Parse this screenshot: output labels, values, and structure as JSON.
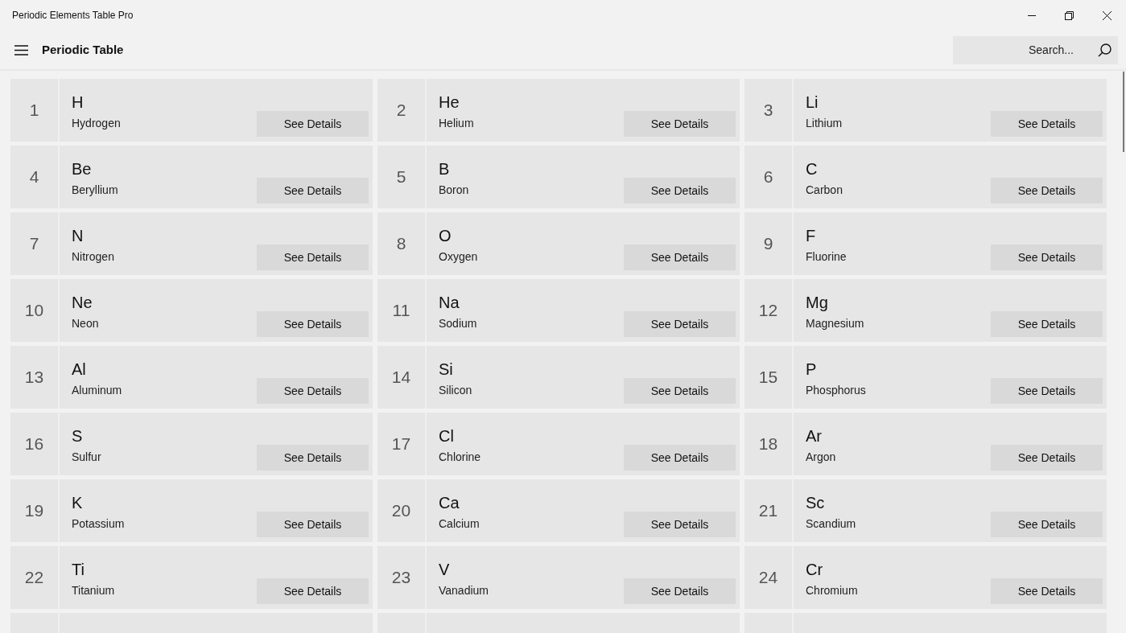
{
  "window": {
    "title": "Periodic Elements Table Pro"
  },
  "header": {
    "title": "Periodic Table",
    "search": {
      "placeholder": "Search..."
    }
  },
  "elements": [
    {
      "kind": "full",
      "number": "1",
      "symbol": "H",
      "name": "Hydrogen",
      "button": "See Details"
    },
    {
      "kind": "full",
      "number": "2",
      "symbol": "He",
      "name": "Helium",
      "button": "See Details"
    },
    {
      "kind": "full",
      "number": "3",
      "symbol": "Li",
      "name": "Lithium",
      "button": "See Details"
    },
    {
      "kind": "full",
      "number": "4",
      "symbol": "Be",
      "name": "Beryllium",
      "button": "See Details"
    },
    {
      "kind": "full",
      "number": "5",
      "symbol": "B",
      "name": "Boron",
      "button": "See Details"
    },
    {
      "kind": "full",
      "number": "6",
      "symbol": "C",
      "name": "Carbon",
      "button": "See Details"
    },
    {
      "kind": "full",
      "number": "7",
      "symbol": "N",
      "name": "Nitrogen",
      "button": "See Details"
    },
    {
      "kind": "full",
      "number": "8",
      "symbol": "O",
      "name": "Oxygen",
      "button": "See Details"
    },
    {
      "kind": "full",
      "number": "9",
      "symbol": "F",
      "name": "Fluorine",
      "button": "See Details"
    },
    {
      "kind": "full",
      "number": "10",
      "symbol": "Ne",
      "name": "Neon",
      "button": "See Details"
    },
    {
      "kind": "full",
      "number": "11",
      "symbol": "Na",
      "name": "Sodium",
      "button": "See Details"
    },
    {
      "kind": "full",
      "number": "12",
      "symbol": "Mg",
      "name": "Magnesium",
      "button": "See Details"
    },
    {
      "kind": "full",
      "number": "13",
      "symbol": "Al",
      "name": "Aluminum",
      "button": "See Details"
    },
    {
      "kind": "full",
      "number": "14",
      "symbol": "Si",
      "name": "Silicon",
      "button": "See Details"
    },
    {
      "kind": "full",
      "number": "15",
      "symbol": "P",
      "name": "Phosphorus",
      "button": "See Details"
    },
    {
      "kind": "full",
      "number": "16",
      "symbol": "S",
      "name": "Sulfur",
      "button": "See Details"
    },
    {
      "kind": "full",
      "number": "17",
      "symbol": "Cl",
      "name": "Chlorine",
      "button": "See Details"
    },
    {
      "kind": "full",
      "number": "18",
      "symbol": "Ar",
      "name": "Argon",
      "button": "See Details"
    },
    {
      "kind": "full",
      "number": "19",
      "symbol": "K",
      "name": "Potassium",
      "button": "See Details"
    },
    {
      "kind": "full",
      "number": "20",
      "symbol": "Ca",
      "name": "Calcium",
      "button": "See Details"
    },
    {
      "kind": "full",
      "number": "21",
      "symbol": "Sc",
      "name": "Scandium",
      "button": "See Details"
    },
    {
      "kind": "full",
      "number": "22",
      "symbol": "Ti",
      "name": "Titanium",
      "button": "See Details"
    },
    {
      "kind": "full",
      "number": "23",
      "symbol": "V",
      "name": "Vanadium",
      "button": "See Details"
    },
    {
      "kind": "full",
      "number": "24",
      "symbol": "Cr",
      "name": "Chromium",
      "button": "See Details"
    },
    {
      "kind": "cut"
    },
    {
      "kind": "cut"
    },
    {
      "kind": "cut"
    }
  ]
}
